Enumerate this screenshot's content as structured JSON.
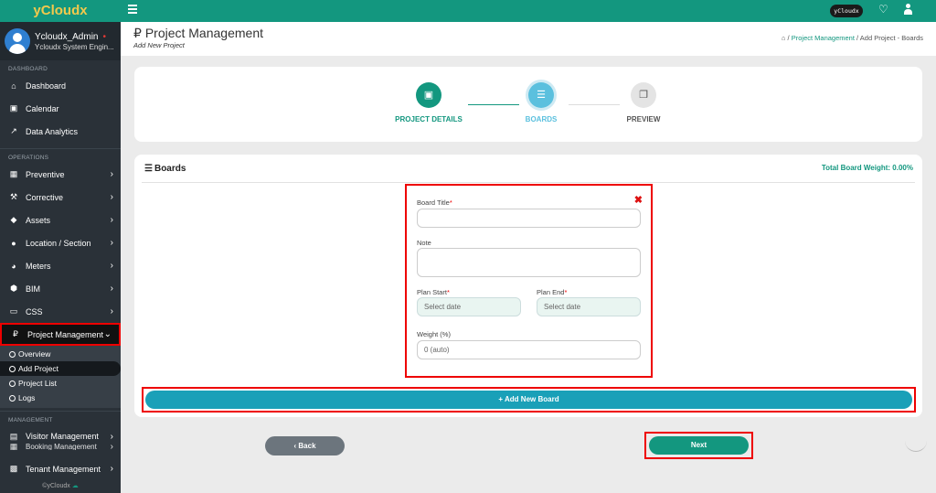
{
  "app": {
    "logo": "yCloudx",
    "brand_pill": "yCloudx",
    "footer": "©yCloudx"
  },
  "user": {
    "name": "Ycloudx_Admin",
    "status_dot": "•",
    "role": "Ycloudx System Engin..."
  },
  "sidebar": {
    "sections": {
      "dashboard": "DASHBOARD",
      "operations": "OPERATIONS",
      "management": "MANAGEMENT"
    },
    "dashboard_items": [
      {
        "label": "Dashboard",
        "icon": "home-icon"
      },
      {
        "label": "Calendar",
        "icon": "calendar-check-icon"
      },
      {
        "label": "Data Analytics",
        "icon": "chart-line-icon"
      }
    ],
    "operations_items": [
      {
        "label": "Preventive",
        "icon": "calendar-icon"
      },
      {
        "label": "Corrective",
        "icon": "wrench-icon"
      },
      {
        "label": "Assets",
        "icon": "tag-icon"
      },
      {
        "label": "Location / Section",
        "icon": "globe-icon"
      },
      {
        "label": "Meters",
        "icon": "gauge-icon"
      },
      {
        "label": "BIM",
        "icon": "cube-icon"
      },
      {
        "label": "CSS",
        "icon": "monitor-icon"
      },
      {
        "label": "Project Management",
        "icon": "project-icon"
      }
    ],
    "project_sub_items": [
      "Overview",
      "Add Project",
      "Project List",
      "Logs"
    ],
    "management_items": [
      {
        "label": "Visitor Management",
        "icon": "id-card-icon"
      },
      {
        "label": "Booking Management",
        "icon": "calendar-icon"
      },
      {
        "label": "Tenant Management",
        "icon": "building-icon"
      }
    ]
  },
  "header": {
    "title": "Project Management",
    "title_icon": "₽",
    "subtitle": "Add New Project",
    "breadcrumb": {
      "sep": "/",
      "link": "Project Management",
      "current": "Add Project - Boards"
    }
  },
  "stepper": {
    "steps": [
      {
        "label": "PROJECT DETAILS",
        "state": "done",
        "color": "#13977f",
        "icon": "▣"
      },
      {
        "label": "BOARDS",
        "state": "active",
        "color": "#5bc0de",
        "icon": "☰"
      },
      {
        "label": "PREVIEW",
        "state": "pending",
        "color": "#e4e4e4",
        "icon": "❐"
      }
    ]
  },
  "boards": {
    "title": "Boards",
    "total_weight": "Total Board Weight: 0.00%",
    "form": {
      "board_title_label": "Board Title",
      "note_label": "Note",
      "plan_start_label": "Plan Start",
      "plan_end_label": "Plan End",
      "date_placeholder": "Select date",
      "weight_label": "Weight (%)",
      "weight_placeholder": "0 (auto)",
      "required_mark": "*",
      "close_icon": "✖"
    },
    "add_button": "Add New Board",
    "add_icon": "+"
  },
  "actions": {
    "back": "Back",
    "back_icon": "‹",
    "next": "Next"
  },
  "colors": {
    "primary": "#13977f",
    "accent_blue": "#1aa0b8",
    "highlight": "#e00000"
  }
}
